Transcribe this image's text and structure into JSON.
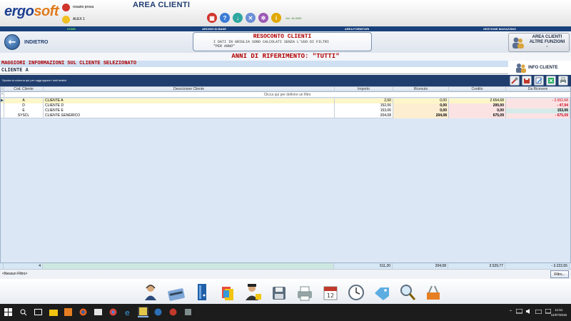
{
  "header": {
    "logo_a": "ergo",
    "logo_b": "soft",
    "user_top": "rosario prova",
    "user_bottom": "ALEX 1",
    "app_title": "AREA CLIENTI",
    "version": "Ver. 16.0030"
  },
  "menu": [
    "HOME",
    "ARCHIVI DI BASE",
    "AREA FORNITORI",
    "GESTIONE MAGAZZINO"
  ],
  "nav": {
    "back_label": "INDIETRO",
    "resoconto_title": "RESOCONTO CLIENTI",
    "resoconto_note1": "I DATI IN GRIGLIA SONO CALCOLATI SENZA L'USO DI FILTRI",
    "resoconto_note2": "\"PER ANNO\"",
    "altre_line1": "AREA CLIENTI",
    "altre_line2": "ALTRE FUNZIONI",
    "altre_line3": "-"
  },
  "anni": "ANNI DI RIFERIMENTO: \"TUTTI\"",
  "info": {
    "title": "MAGGIORI INFORMAZIONI SUL CLIENTE SELEZIONATO",
    "selected": "CLIENTE A",
    "button": "INFO CLIENTE"
  },
  "grid": {
    "group_hint": "Sposta la colonna qui per raggruppare i dati relativi",
    "filter_hint": "Clicca qui per definire un filtro",
    "columns": [
      "Cod. Cliente",
      "Descrizione Cliente",
      "Importo",
      "Ricevuto",
      "Credito",
      "Da Ricevere"
    ],
    "rows": [
      {
        "cod": "A",
        "desc": "CLIENTE A",
        "importo": "2,00",
        "ricevuto": "0,00",
        "credito": "2.654,68",
        "da_ricevere": "- 2.652,68"
      },
      {
        "cod": "D",
        "desc": "CLIENTE D",
        "importo": "152,06",
        "ricevuto": "0,00",
        "credito": "200,00",
        "da_ricevere": "- 47,94"
      },
      {
        "cod": "E",
        "desc": "CLIENTE E",
        "importo": "153,06",
        "ricevuto": "0,00",
        "credito": "0,00",
        "da_ricevere": "153,06"
      },
      {
        "cod": "SYSCL",
        "desc": "CLIENTE GENERICO",
        "importo": "204,08",
        "ricevuto": "204,08",
        "credito": "675,09",
        "da_ricevere": "- 675,09"
      }
    ],
    "totals": {
      "count": "4",
      "importo": "511,20",
      "ricevuto": "204,08",
      "credito": "3.529,77",
      "da_ricevere": "- 3.222,65"
    },
    "no_filter": "<Nessun Filtro>",
    "filter_button": "Filtro..."
  },
  "clock": {
    "time": "11:51",
    "date": "11/07/2016"
  },
  "colors": {
    "navy": "#18407a",
    "accent_red": "#b00000",
    "logo_blue": "#1e3f91",
    "logo_orange": "#e07a1b"
  }
}
